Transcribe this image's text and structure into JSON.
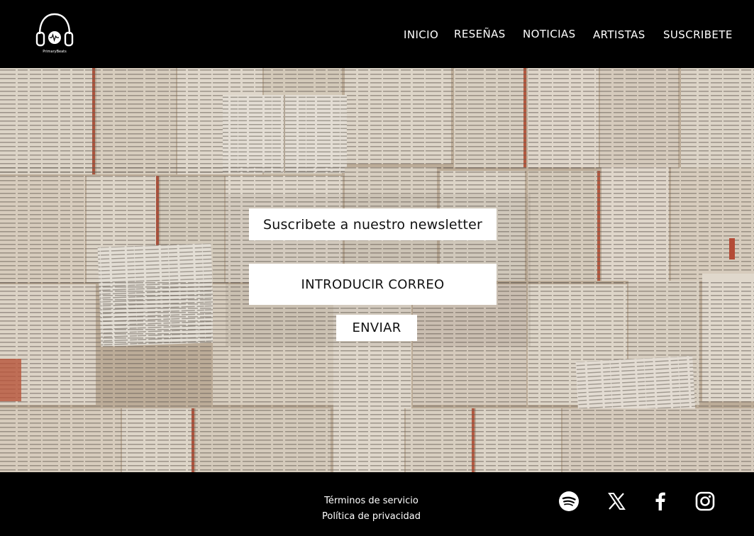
{
  "header": {
    "logo_text": "PrimaryBeats",
    "nav": [
      {
        "label": "INICIO"
      },
      {
        "label": "RESEÑAS"
      },
      {
        "label": "NOTICIAS"
      },
      {
        "label": "ARTISTAS"
      },
      {
        "label": "SUSCRIBETE"
      }
    ]
  },
  "newsletter": {
    "title": "Suscribete a nuestro newsletter",
    "email_placeholder": "INTRODUCIR CORREO",
    "submit_label": "ENVIAR"
  },
  "footer": {
    "links": [
      {
        "label": "Términos de servicio"
      },
      {
        "label": "Política de privacidad"
      }
    ],
    "social": [
      {
        "icon": "spotify-icon"
      },
      {
        "icon": "x-twitter-icon"
      },
      {
        "icon": "facebook-icon"
      },
      {
        "icon": "instagram-icon"
      }
    ]
  },
  "colors": {
    "background": "#000000",
    "text_light": "#ffffff",
    "box_bg": "#ffffff",
    "text_dark": "#111111"
  }
}
